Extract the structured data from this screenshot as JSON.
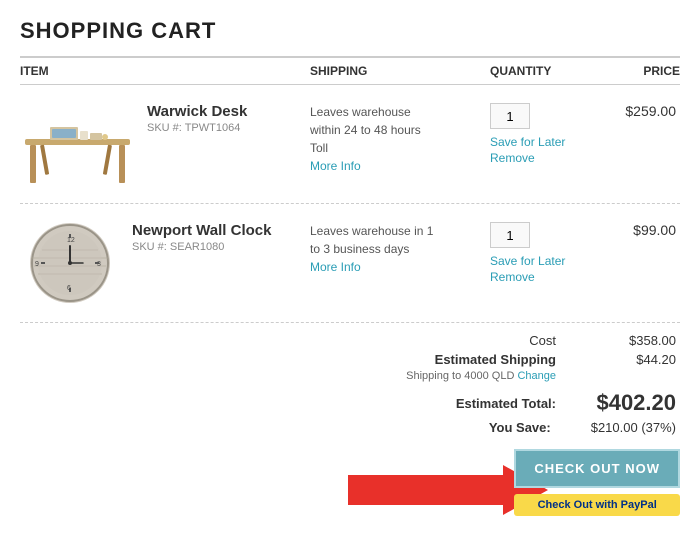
{
  "page": {
    "title": "SHOPPING CART",
    "header": {
      "item_col": "ITEM",
      "shipping_col": "SHIPPING",
      "quantity_col": "QUANTITY",
      "price_col": "PRICE"
    },
    "items": [
      {
        "id": "item-1",
        "name": "Warwick Desk",
        "sku": "SKU #: TPWT1064",
        "shipping_line1": "Leaves warehouse",
        "shipping_line2": "within 24 to 48 hours",
        "shipping_line3": "Toll",
        "more_info": "More Info",
        "quantity": "1",
        "save_for_later": "Save for Later",
        "remove": "Remove",
        "price": "$259.00"
      },
      {
        "id": "item-2",
        "name": "Newport Wall Clock",
        "sku": "SKU #: SEAR1080",
        "shipping_line1": "Leaves warehouse in 1",
        "shipping_line2": "to 3 business days",
        "more_info": "More Info",
        "quantity": "1",
        "save_for_later": "Save for Later",
        "remove": "Remove",
        "price": "$99.00"
      }
    ],
    "summary": {
      "cost_label": "Cost",
      "cost_value": "$358.00",
      "shipping_label": "Estimated Shipping",
      "shipping_sublabel": "Shipping to 4000 QLD",
      "change_link": "Change",
      "shipping_value": "$44.20",
      "total_label": "Estimated Total:",
      "total_value": "$402.20",
      "save_label": "You Save:",
      "save_value": "$210.00 (37%)"
    },
    "buttons": {
      "checkout": "CHECK OUT NOW",
      "paypal": "Check Out with PayPal"
    }
  }
}
